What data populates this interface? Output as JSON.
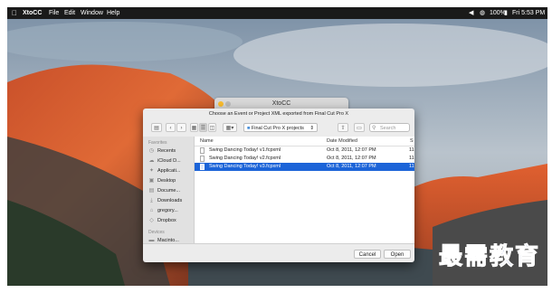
{
  "menubar": {
    "app_name": "XtoCC",
    "items": [
      "File",
      "Edit",
      "Window",
      "Help"
    ],
    "battery": "100%",
    "time": "Fri 5:53 PM"
  },
  "background_window": {
    "title": "XtoCC"
  },
  "dialog": {
    "message": "Choose an Event or Project XML exported from Final Cut Pro X",
    "path": "Final Cut Pro X projects",
    "search_placeholder": "Search",
    "sidebar": {
      "favorites_header": "Favorites",
      "favorites": [
        {
          "label": "Recents",
          "icon": "clock-icon"
        },
        {
          "label": "iCloud D...",
          "icon": "cloud-icon"
        },
        {
          "label": "Applicati...",
          "icon": "applications-icon"
        },
        {
          "label": "Desktop",
          "icon": "desktop-icon"
        },
        {
          "label": "Docume...",
          "icon": "documents-icon"
        },
        {
          "label": "Downloads",
          "icon": "downloads-icon"
        },
        {
          "label": "gregory...",
          "icon": "home-icon"
        },
        {
          "label": "Dropbox",
          "icon": "dropbox-icon"
        }
      ],
      "devices_header": "Devices",
      "devices": [
        {
          "label": "Macinto...",
          "icon": "disk-icon"
        }
      ]
    },
    "columns": {
      "name": "Name",
      "date": "Date Modified",
      "size": "S"
    },
    "files": [
      {
        "name": "Swing Dancing Today! v1.fcpxml",
        "date": "Oct 8, 2011, 12:07 PM",
        "size": "11",
        "selected": false
      },
      {
        "name": "Swing Dancing Today! v2.fcpxml",
        "date": "Oct 8, 2011, 12:07 PM",
        "size": "11",
        "selected": false
      },
      {
        "name": "Swing Dancing Today! v3.fcpxml",
        "date": "Oct 8, 2011, 12:07 PM",
        "size": "11",
        "selected": true
      }
    ],
    "cancel_label": "Cancel",
    "open_label": "Open"
  },
  "watermark": "最需教育",
  "colors": {
    "selection": "#1c64d8",
    "menubar": "#1a1a1a",
    "watermark": "#1b3a9c"
  }
}
